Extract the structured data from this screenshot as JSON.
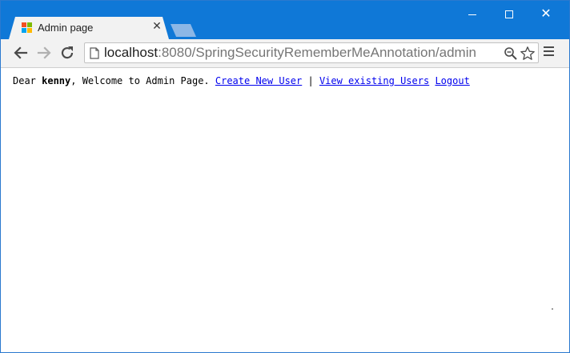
{
  "browser": {
    "tab": {
      "title": "Admin page",
      "favicon": "windows-logo-icon",
      "close_icon": "close-icon"
    },
    "new_tab_icon": "new-tab-icon",
    "window_controls": {
      "minimize_icon": "minimize-icon",
      "maximize_icon": "maximize-icon",
      "close_icon": "window-close-icon"
    },
    "toolbar": {
      "back_icon": "back-arrow-icon",
      "forward_icon": "forward-arrow-icon",
      "reload_icon": "reload-icon",
      "url_host": "localhost",
      "url_rest": ":8080/SpringSecurityRememberMeAnnotation/admin",
      "zoom_icon": "zoom-icon",
      "bookmark_icon": "star-icon",
      "menu_icon": "hamburger-menu-icon"
    }
  },
  "page": {
    "greeting_prefix": "Dear ",
    "username": "kenny",
    "greeting_suffix": ", Welcome to Admin Page. ",
    "create_user_link": "Create New User",
    "separator": " | ",
    "view_users_link": "View existing Users",
    "logout_link": "Logout"
  },
  "colors": {
    "titlebar": "#0f78d7",
    "tab": "#f2f2f2",
    "link": "#0000ee"
  }
}
